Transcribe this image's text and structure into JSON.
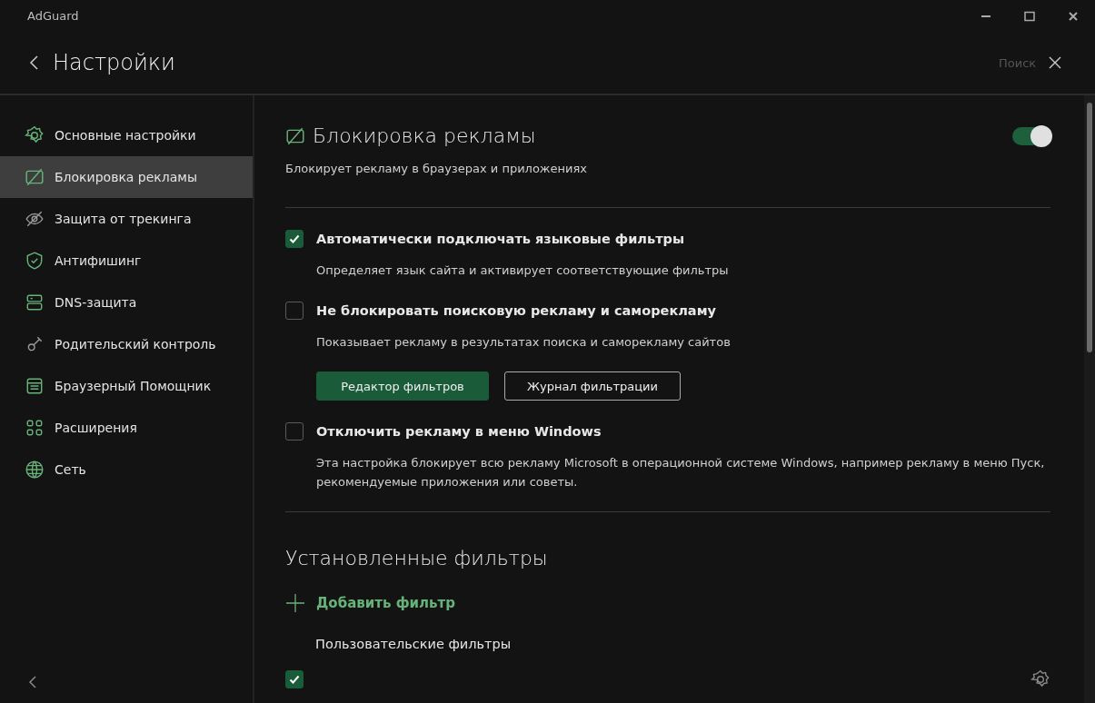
{
  "window": {
    "title": "AdGuard"
  },
  "header": {
    "title": "Настройки",
    "search_placeholder": "Поиск"
  },
  "sidebar": {
    "items": [
      {
        "label": "Основные настройки",
        "selected": false
      },
      {
        "label": "Блокировка рекламы",
        "selected": true
      },
      {
        "label": "Защита от трекинга",
        "selected": false
      },
      {
        "label": "Антифишинг",
        "selected": false
      },
      {
        "label": "DNS-защита",
        "selected": false
      },
      {
        "label": "Родительский контроль",
        "selected": false
      },
      {
        "label": "Браузерный Помощник",
        "selected": false
      },
      {
        "label": "Расширения",
        "selected": false
      },
      {
        "label": "Сеть",
        "selected": false
      }
    ]
  },
  "section": {
    "title": "Блокировка рекламы",
    "on": true,
    "description": "Блокирует рекламу в браузерах и приложениях",
    "items": [
      {
        "kind": "option",
        "title": "Автоматически подключать языковые фильтры",
        "description": "Определяет язык сайта и активирует соответствующие фильтры",
        "checked": true
      },
      {
        "kind": "option",
        "title": "Не блокировать поисковую рекламу и саморекламу",
        "description": "Показывает рекламу в результатах поиска и саморекламу сайтов",
        "checked": false
      },
      {
        "kind": "buttons",
        "buttons": [
          {
            "label": "Редактор фильтров",
            "primary": true
          },
          {
            "label": "Журнал фильтрации",
            "primary": false
          }
        ]
      },
      {
        "kind": "option",
        "title": "Отключить рекламу в меню Windows",
        "description": "Эта настройка блокирует всю рекламу Microsoft в операционной системе Windows, например рекламу в меню Пуск, рекомендуемые приложения или советы.",
        "checked": false
      }
    ]
  },
  "filters": {
    "title": "Установленные фильтры",
    "add_label": "Добавить фильтр",
    "group_title": "Пользовательские фильтры",
    "rows": [
      {
        "checked": true
      }
    ]
  }
}
